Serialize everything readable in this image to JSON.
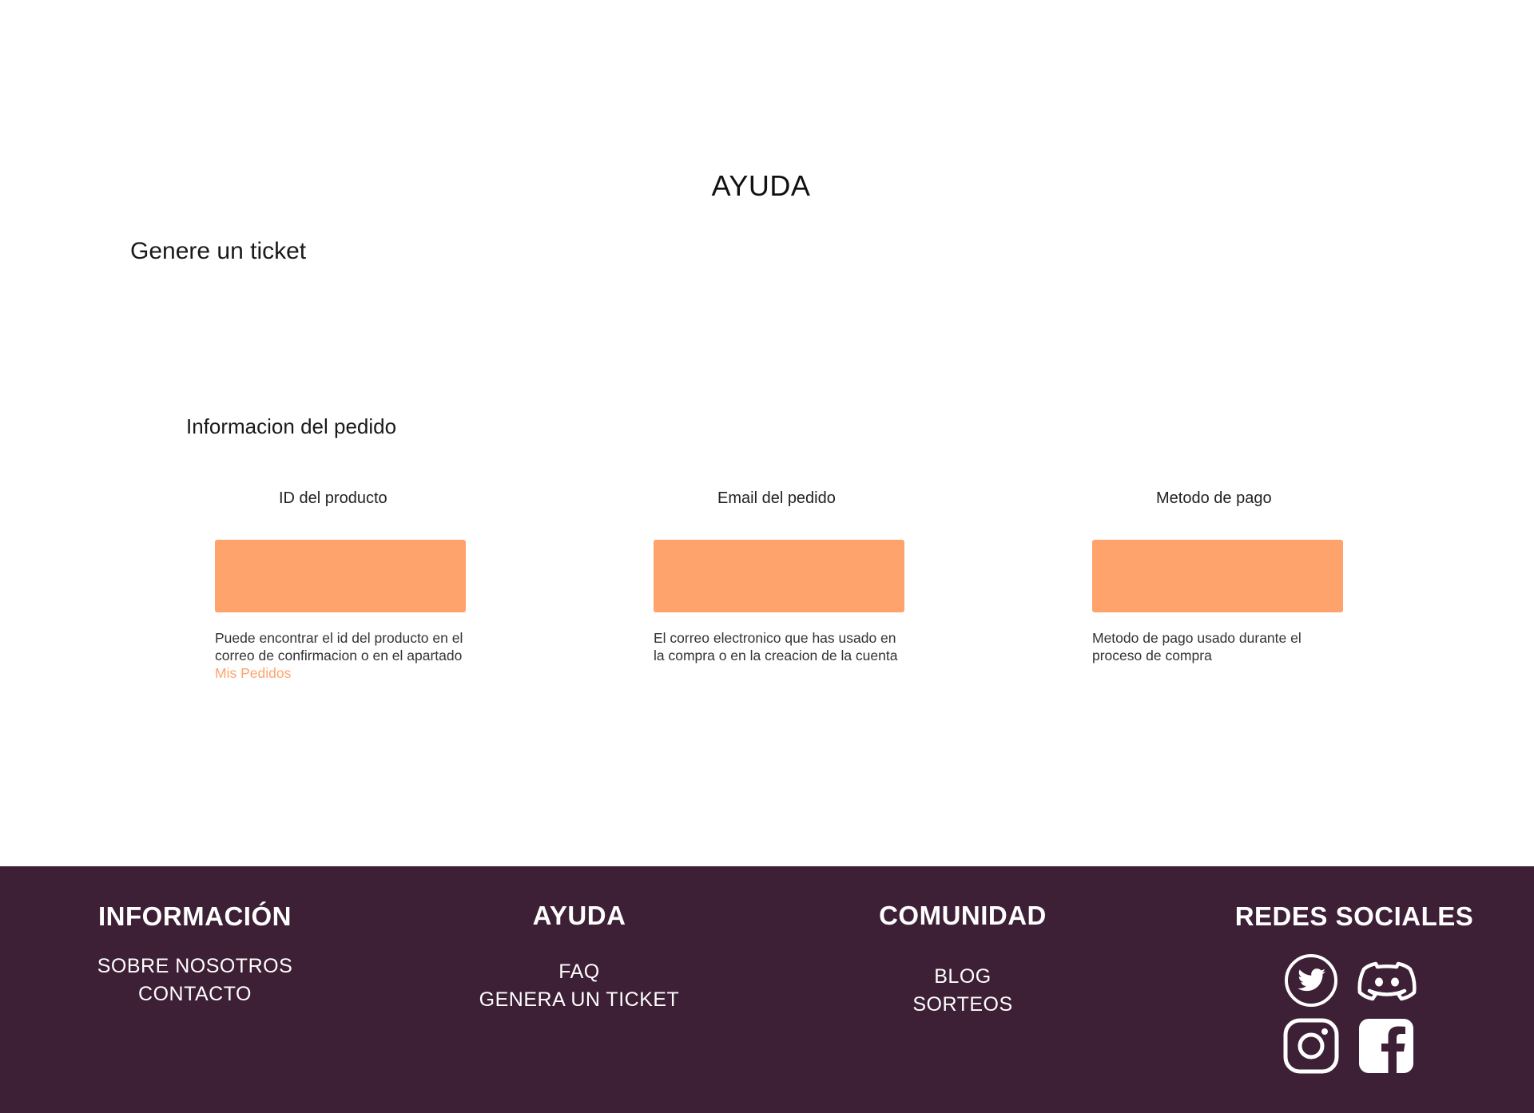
{
  "page": {
    "title": "AYUDA",
    "section_title": "Genere un ticket",
    "subsection_title": "Informacion del pedido"
  },
  "form": {
    "fields": [
      {
        "label": "ID del producto",
        "value": "",
        "help": "Puede encontrar el id del producto en el correo de confirmacion o en el apartado ",
        "help_link": "Mis Pedidos"
      },
      {
        "label": "Email del pedido",
        "value": "",
        "help": "El correo electronico que has usado en la compra o en la creacion de la cuenta"
      },
      {
        "label": "Metodo de pago",
        "value": "",
        "help": "Metodo de pago usado durante el proceso de compra"
      }
    ]
  },
  "footer": {
    "informacion": {
      "title": "INFORMACIÓN",
      "links": [
        "SOBRE NOSOTROS",
        "CONTACTO"
      ]
    },
    "ayuda": {
      "title": "AYUDA",
      "links": [
        "FAQ",
        "GENERA UN TICKET"
      ]
    },
    "comunidad": {
      "title": "COMUNIDAD",
      "links": [
        "BLOG",
        "SORTEOS"
      ]
    },
    "redes": {
      "title": "REDES SOCIALES",
      "icons": [
        "twitter-icon",
        "discord-icon",
        "instagram-icon",
        "facebook-icon"
      ]
    }
  },
  "colors": {
    "accent": "#ffa36c",
    "footer_bg": "#3d1f36",
    "footer_text": "#ffffff"
  }
}
